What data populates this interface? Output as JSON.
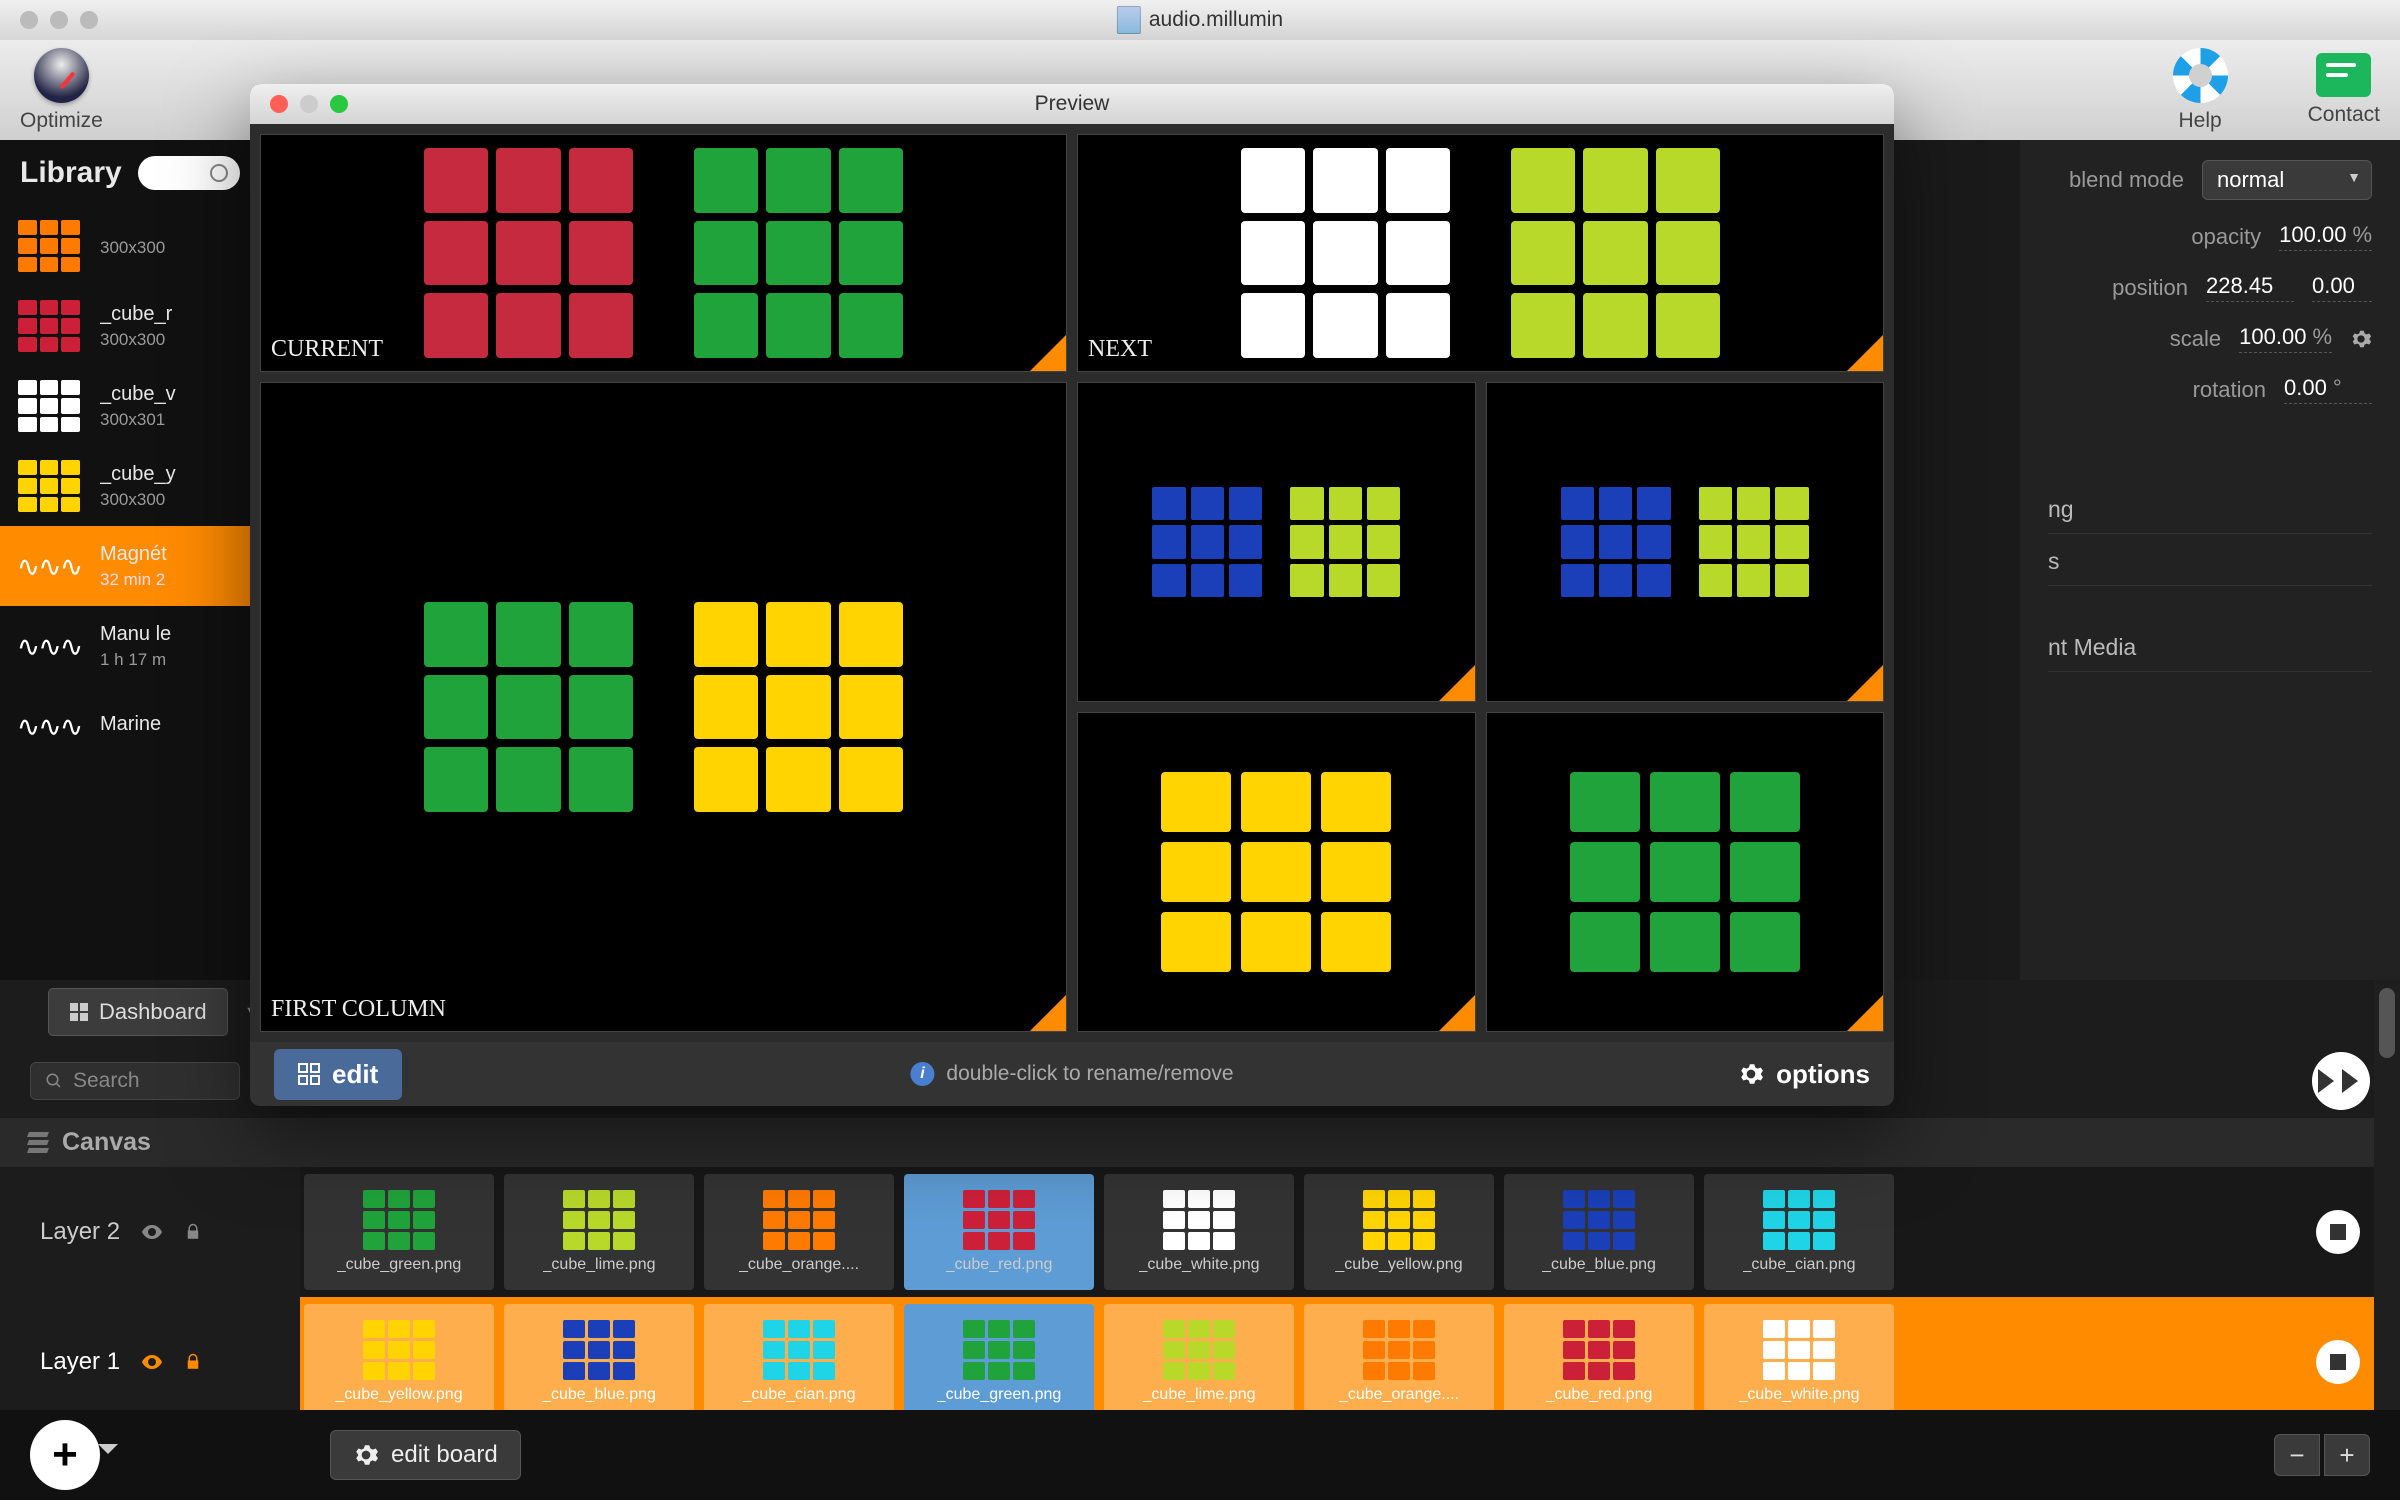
{
  "window_title": "audio.millumin",
  "toolbar": {
    "optimize": "Optimize",
    "help": "Help",
    "contact": "Contact"
  },
  "library": {
    "title": "Library",
    "search_placeholder": "",
    "items": [
      {
        "name": "",
        "dims": "300x300",
        "color": "#ff7a00"
      },
      {
        "name": "_cube_r",
        "dims": "300x300",
        "color": "#cc2038"
      },
      {
        "name": "_cube_v",
        "dims": "300x301",
        "color": "#ffffff"
      },
      {
        "name": "_cube_y",
        "dims": "300x300",
        "color": "#ffd400"
      },
      {
        "name": "Magnét",
        "dims": "32 min 2",
        "type": "audio"
      },
      {
        "name": "Manu le",
        "dims": "1 h  17 m",
        "type": "audio"
      },
      {
        "name": "Marine",
        "dims": "",
        "type": "audio"
      }
    ]
  },
  "properties": {
    "blend_mode_label": "blend mode",
    "blend_mode_value": "normal",
    "opacity_label": "opacity",
    "opacity_value": "100.00",
    "opacity_unit": "%",
    "position_label": "position",
    "position_x": "228.45",
    "position_y": "0.00",
    "scale_label": "scale",
    "scale_value": "100.00",
    "scale_unit": "%",
    "rotation_label": "rotation",
    "rotation_value": "0.00",
    "rotation_unit": "°",
    "section_ng": "ng",
    "section_s": "s",
    "section_media": "nt Media"
  },
  "timeline": {
    "dashboard_tab": "Dashboard",
    "search_placeholder": "Search",
    "canvas_label": "Canvas",
    "layers": [
      {
        "name": "Layer 2",
        "clips": [
          {
            "label": "_cube_green.png",
            "color": "#1fa33a"
          },
          {
            "label": "_cube_lime.png",
            "color": "#b8d82a"
          },
          {
            "label": "_cube_orange....",
            "color": "#ff7a00"
          },
          {
            "label": "_cube_red.png",
            "color": "#cc2038",
            "selected": true
          },
          {
            "label": "_cube_white.png",
            "color": "#ffffff"
          },
          {
            "label": "_cube_yellow.png",
            "color": "#ffd400"
          },
          {
            "label": "_cube_blue.png",
            "color": "#1a3fb8"
          },
          {
            "label": "_cube_cian.png",
            "color": "#1fd4e6"
          }
        ]
      },
      {
        "name": "Layer 1",
        "active": true,
        "clips": [
          {
            "label": "_cube_yellow.png",
            "color": "#ffd400"
          },
          {
            "label": "_cube_blue.png",
            "color": "#1a3fb8"
          },
          {
            "label": "_cube_cian.png",
            "color": "#1fd4e6"
          },
          {
            "label": "_cube_green.png",
            "color": "#1fa33a",
            "selected": true
          },
          {
            "label": "_cube_lime.png",
            "color": "#b8d82a"
          },
          {
            "label": "_cube_orange....",
            "color": "#ff7a00"
          },
          {
            "label": "_cube_red.png",
            "color": "#cc2038"
          },
          {
            "label": "_cube_white.png",
            "color": "#ffffff"
          }
        ]
      }
    ],
    "edit_board": "edit board"
  },
  "preview": {
    "title": "Preview",
    "current_label": "CURRENT",
    "next_label": "NEXT",
    "first_column_label": "FIRST COLUMN",
    "edit_btn": "edit",
    "hint": "double-click to rename/remove",
    "options_btn": "options",
    "panes": {
      "current": [
        {
          "color": "#c52a3e"
        },
        {
          "color": "#1fa33a"
        }
      ],
      "next": [
        {
          "color": "#ffffff"
        },
        {
          "color": "#b8d82a"
        }
      ],
      "first_column": [
        {
          "color": "#1fa33a"
        },
        {
          "color": "#ffd400"
        }
      ],
      "small": [
        [
          {
            "color": "#b8d82a"
          },
          {
            "color": "#1a3fb8"
          }
        ],
        [
          {
            "color": "#b8d82a"
          },
          {
            "color": "#1a3fb8"
          }
        ],
        [
          {
            "color": "#ffd400"
          }
        ],
        [
          {
            "color": "#1fa33a"
          }
        ]
      ]
    }
  },
  "colors": {
    "accent": "#ff8b00",
    "selection": "#5d9cd4"
  }
}
